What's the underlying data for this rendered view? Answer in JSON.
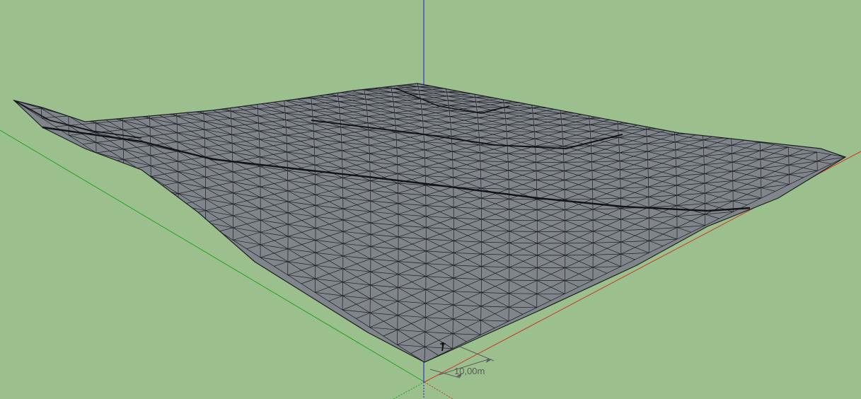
{
  "viewport": {
    "background": "#9cbf8e"
  },
  "terrain": {
    "face_color": "#7f858b",
    "edge_color": "#1c1f22"
  },
  "axes": {
    "red_axis_color": "#c83a2a",
    "green_axis_color": "#1fa51f",
    "blue_axis_color": "#1a1ad6"
  },
  "dimension": {
    "label": "10,00m",
    "color": "#5a5a5a"
  },
  "cursor": {
    "icon": "pencil-cursor-icon"
  }
}
